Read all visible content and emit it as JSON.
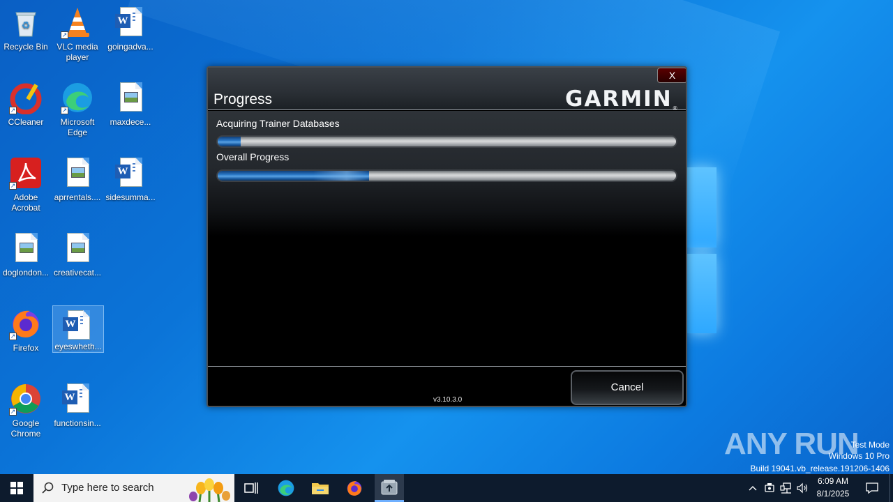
{
  "desktop": {
    "icons": [
      {
        "label": "Recycle Bin",
        "type": "recycle-bin"
      },
      {
        "label": "VLC media player",
        "type": "vlc"
      },
      {
        "label": "goingadva...",
        "type": "word"
      },
      {
        "label": "CCleaner",
        "type": "ccleaner"
      },
      {
        "label": "Microsoft Edge",
        "type": "edge"
      },
      {
        "label": "maxdece...",
        "type": "image"
      },
      {
        "label": "Adobe Acrobat",
        "type": "acrobat"
      },
      {
        "label": "aprrentals....",
        "type": "image"
      },
      {
        "label": "sidesumma...",
        "type": "word"
      },
      {
        "label": "doglondon...",
        "type": "image"
      },
      {
        "label": "creativecat...",
        "type": "image"
      },
      {
        "label": "Firefox",
        "type": "firefox"
      },
      {
        "label": "eyeswheth...",
        "type": "word"
      },
      {
        "label": "Google Chrome",
        "type": "chrome"
      },
      {
        "label": "functionsin...",
        "type": "word"
      }
    ]
  },
  "dialog": {
    "title": "Progress",
    "brand": "GARMIN",
    "close_label": "X",
    "task_label": "Acquiring Trainer Databases",
    "task_progress": 0.05,
    "overall_label": "Overall Progress",
    "overall_progress": 0.33,
    "version": "v3.10.3.0",
    "cancel_label": "Cancel"
  },
  "taskbar": {
    "search_placeholder": "Type here to search",
    "pinned": [
      "task-view-icon",
      "edge-icon",
      "file-explorer-icon",
      "firefox-icon",
      "garmin-express-icon"
    ],
    "time": "6:09 AM",
    "date": "8/1/2025"
  },
  "watermark": {
    "line1": "Test Mode",
    "line2": "Windows 10 Pro",
    "line3": "Build 19041.vb_release.191206-1406",
    "brand": "ANY RUN"
  },
  "colors": {
    "desktop_bg": "#0b74d8",
    "progress_fill": "#2a78c7",
    "taskbar_bg": "#0d1b2d"
  }
}
